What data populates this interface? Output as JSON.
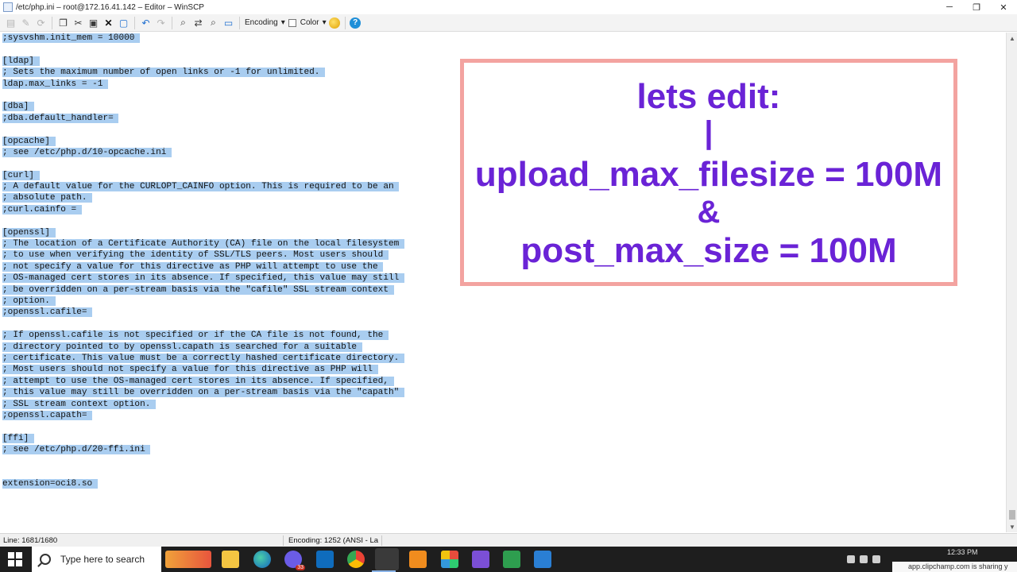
{
  "window": {
    "title": "/etc/php.ini – root@172.16.41.142 – Editor – WinSCP",
    "minimize": "─",
    "restore": "❐",
    "close": "✕"
  },
  "toolbar": {
    "encoding_label": "Encoding",
    "color_label": "Color",
    "dropdown_arrow": "▾",
    "help_glyph": "?"
  },
  "editor": {
    "lines": [
      ";sysvshm.init_mem = 10000",
      "",
      "[ldap]",
      "; Sets the maximum number of open links or -1 for unlimited.",
      "ldap.max_links = -1",
      "",
      "[dba]",
      ";dba.default_handler=",
      "",
      "[opcache]",
      "; see /etc/php.d/10-opcache.ini",
      "",
      "[curl]",
      "; A default value for the CURLOPT_CAINFO option. This is required to be an",
      "; absolute path.",
      ";curl.cainfo =",
      "",
      "[openssl]",
      "; The location of a Certificate Authority (CA) file on the local filesystem",
      "; to use when verifying the identity of SSL/TLS peers. Most users should",
      "; not specify a value for this directive as PHP will attempt to use the",
      "; OS-managed cert stores in its absence. If specified, this value may still",
      "; be overridden on a per-stream basis via the \"cafile\" SSL stream context",
      "; option.",
      ";openssl.cafile=",
      "",
      "; If openssl.cafile is not specified or if the CA file is not found, the",
      "; directory pointed to by openssl.capath is searched for a suitable",
      "; certificate. This value must be a correctly hashed certificate directory.",
      "; Most users should not specify a value for this directive as PHP will",
      "; attempt to use the OS-managed cert stores in its absence. If specified,",
      "; this value may still be overridden on a per-stream basis via the \"capath\"",
      "; SSL stream context option.",
      ";openssl.capath=",
      "",
      "[ffi]",
      "; see /etc/php.d/20-ffi.ini",
      "",
      "",
      "extension=oci8.so",
      "",
      ""
    ]
  },
  "statusbar": {
    "line": "Line: 1681/1680",
    "encoding": "Encoding: 1252  (ANSI - La"
  },
  "overlay": {
    "line1": "lets edit:",
    "line2": "|",
    "line3": "upload_max_filesize = 100M",
    "line4": "&",
    "line5": "post_max_size = 100M"
  },
  "taskbar": {
    "search_placeholder": "Type here to search",
    "mail_badge": "33",
    "time": "12:33 PM",
    "sharing_notice": "app.clipchamp.com is sharing y"
  },
  "colors": {
    "selection": "#a9cdf0",
    "overlay_border": "#f3a3a0",
    "overlay_text": "#6a23d6"
  }
}
